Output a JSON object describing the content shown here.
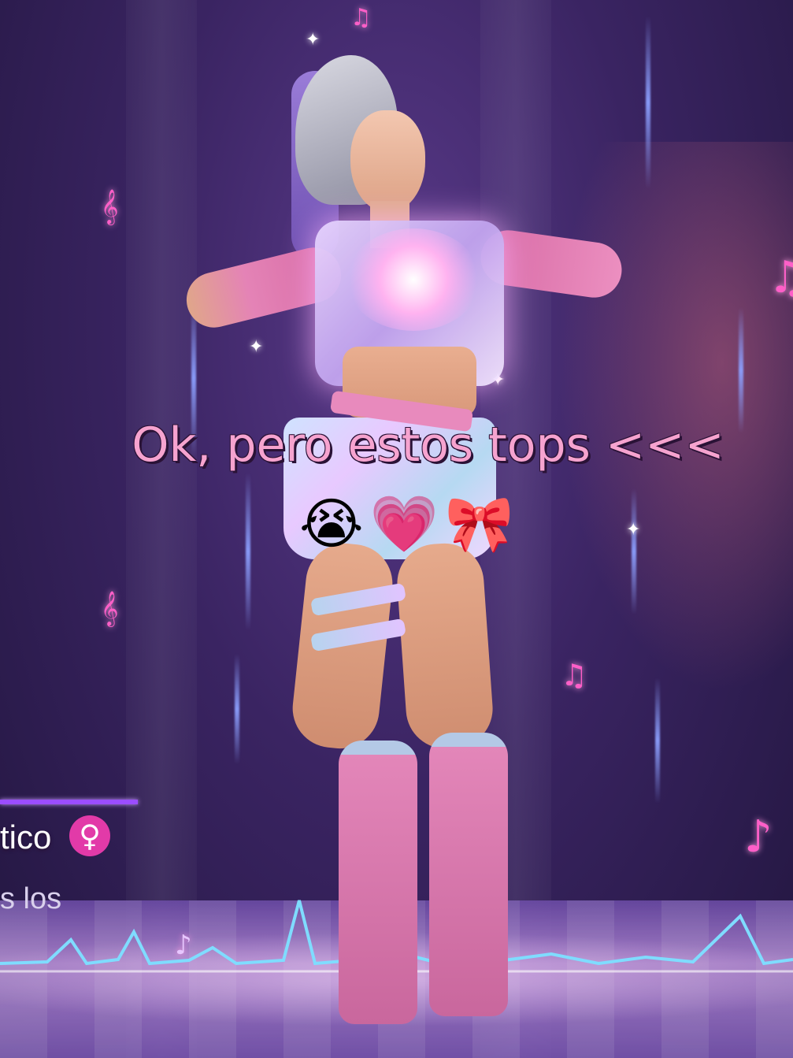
{
  "caption": {
    "text": "Ok, pero estos tops <<<",
    "emojis": [
      "😭",
      "💗",
      "🎀"
    ]
  },
  "hud": {
    "character_name_fragment": "tico",
    "gender_icon": "female-sign-icon",
    "gender_symbol": "♀",
    "subtitle_fragment": "s los"
  },
  "decor": {
    "note_symbols": [
      "𝄞",
      "♪",
      "♫"
    ],
    "sparkle_symbol": "✦",
    "colors": {
      "caption": "#f6a3cf",
      "accent": "#9b4dff",
      "gender_badge": "#e23aa8"
    }
  }
}
